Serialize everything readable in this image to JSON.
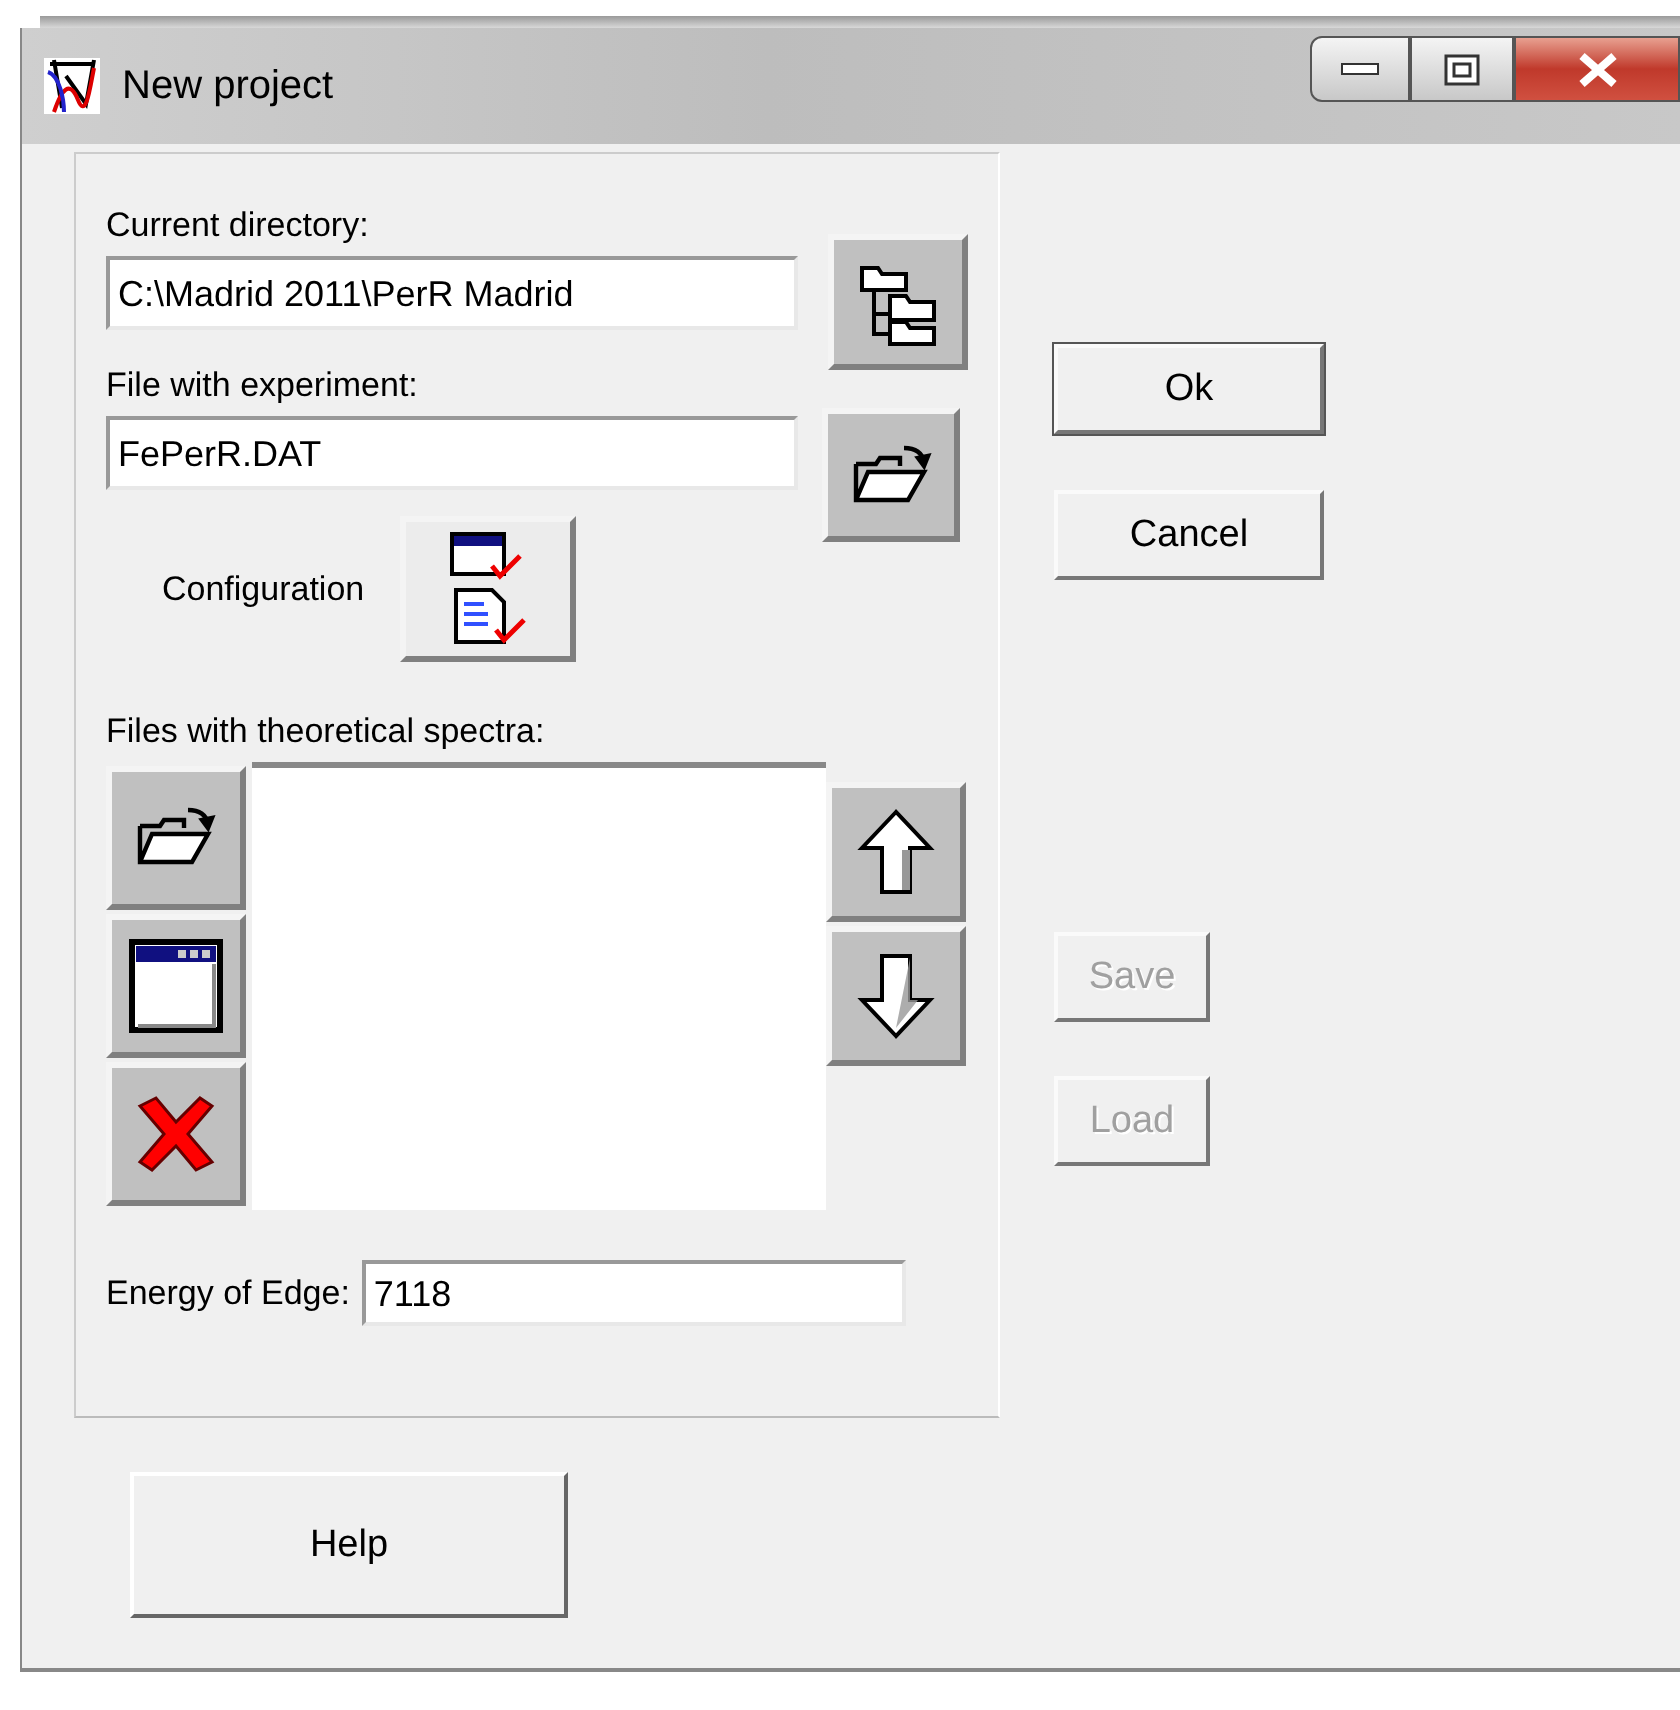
{
  "window": {
    "title": "New project"
  },
  "fields": [
    {
      "label": "Current directory:",
      "value": "C:\\Madrid 2011\\PerR Madrid"
    },
    {
      "label": "File with experiment:",
      "value": "FePerR.DAT"
    }
  ],
  "configuration": {
    "label": "Configuration"
  },
  "spectra_files": {
    "label": "Files with theoretical spectra:"
  },
  "energy_of_edge": {
    "label": "Energy of Edge:",
    "value": "7118"
  },
  "buttons": [
    {
      "label": "Ok",
      "disabled": false,
      "default": true
    },
    {
      "label": "Cancel",
      "disabled": false,
      "default": false
    },
    {
      "label": "Save",
      "disabled": true,
      "default": false
    },
    {
      "label": "Load",
      "disabled": true,
      "default": false
    }
  ],
  "help_button": {
    "label": "Help"
  }
}
